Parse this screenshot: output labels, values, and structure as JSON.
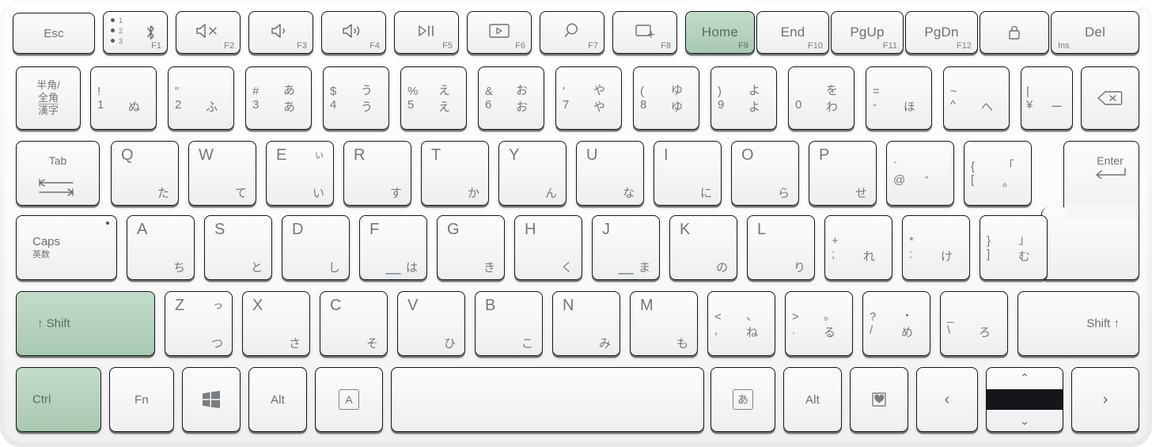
{
  "device": {
    "name": "compact-bluetooth-keyboard",
    "layout": "Japanese JIS 86-key",
    "body_color": "#f4f4f4",
    "key_color": "#f6f7f8",
    "highlight_color": "#b4d2bc",
    "legend_color": "#6d7175"
  },
  "highlighted_keys": [
    "Home",
    "Shift (left)",
    "Ctrl"
  ],
  "rows": {
    "function_row": [
      {
        "id": "esc",
        "main": "Esc"
      },
      {
        "id": "bt",
        "fn": "F1",
        "bt_items": [
          "1",
          "2",
          "3"
        ],
        "icon": "bluetooth-icon"
      },
      {
        "id": "mute",
        "fn": "F2",
        "icon": "volume-mute-icon"
      },
      {
        "id": "voldown",
        "fn": "F3",
        "icon": "volume-down-icon"
      },
      {
        "id": "volup",
        "fn": "F4",
        "icon": "volume-up-icon"
      },
      {
        "id": "playpause",
        "fn": "F5",
        "icon": "play-pause-icon"
      },
      {
        "id": "media",
        "fn": "F6",
        "icon": "media-screen-icon"
      },
      {
        "id": "search",
        "fn": "F7",
        "icon": "search-icon"
      },
      {
        "id": "newwindow",
        "fn": "F8",
        "icon": "new-window-icon"
      },
      {
        "id": "home",
        "fn": "F9",
        "main": "Home",
        "highlight": true
      },
      {
        "id": "end",
        "fn": "F10",
        "main": "End"
      },
      {
        "id": "pgup",
        "fn": "F11",
        "main": "PgUp"
      },
      {
        "id": "pgdn",
        "fn": "F12",
        "main": "PgDn"
      },
      {
        "id": "lock",
        "icon": "lock-icon"
      },
      {
        "id": "del",
        "main": "Del",
        "sub": "Ins"
      }
    ],
    "number_row": [
      {
        "id": "hankaku",
        "lines": [
          "半角/",
          "全角",
          "漢字"
        ]
      },
      {
        "id": "1",
        "tl": "!",
        "tr": "",
        "bl": "1",
        "br": "ぬ"
      },
      {
        "id": "2",
        "tl": "\"",
        "tr": "",
        "bl": "2",
        "br": "ふ"
      },
      {
        "id": "3",
        "tl": "#",
        "tr": "あ",
        "bl": "3",
        "br": "あ"
      },
      {
        "id": "4",
        "tl": "$",
        "tr": "う",
        "bl": "4",
        "br": "う"
      },
      {
        "id": "5",
        "tl": "%",
        "tr": "え",
        "bl": "5",
        "br": "え"
      },
      {
        "id": "6",
        "tl": "&",
        "tr": "お",
        "bl": "6",
        "br": "お"
      },
      {
        "id": "7",
        "tl": "'",
        "tr": "や",
        "bl": "7",
        "br": "や"
      },
      {
        "id": "8",
        "tl": "(",
        "tr": "ゆ",
        "bl": "8",
        "br": "ゆ"
      },
      {
        "id": "9",
        "tl": ")",
        "tr": "よ",
        "bl": "9",
        "br": "よ"
      },
      {
        "id": "0",
        "tl": "",
        "tr": "を",
        "bl": "0",
        "br": "わ"
      },
      {
        "id": "minus",
        "tl": "=",
        "tr": "",
        "bl": "-",
        "br": "ほ"
      },
      {
        "id": "caret",
        "tl": "~",
        "tr": "",
        "bl": "^",
        "br": "へ"
      },
      {
        "id": "yen",
        "tl": "|",
        "tr": "",
        "bl": "¥",
        "br": "ー"
      },
      {
        "id": "backspace",
        "icon": "backspace-icon"
      }
    ],
    "tab_row": [
      {
        "id": "tab",
        "main": "Tab",
        "icon": "tab-arrows-icon"
      },
      {
        "id": "q",
        "roman": "Q",
        "kana": "た"
      },
      {
        "id": "w",
        "roman": "W",
        "kana": "て"
      },
      {
        "id": "e",
        "roman": "E",
        "kana": "い",
        "kana_top": "ぃ"
      },
      {
        "id": "r",
        "roman": "R",
        "kana": "す"
      },
      {
        "id": "t",
        "roman": "T",
        "kana": "か"
      },
      {
        "id": "y",
        "roman": "Y",
        "kana": "ん"
      },
      {
        "id": "u",
        "roman": "U",
        "kana": "な"
      },
      {
        "id": "i",
        "roman": "I",
        "kana": "に"
      },
      {
        "id": "o",
        "roman": "O",
        "kana": "ら"
      },
      {
        "id": "p",
        "roman": "P",
        "kana": "せ"
      },
      {
        "id": "at",
        "tl": "`",
        "tr": "",
        "bl": "@",
        "br": "゛"
      },
      {
        "id": "bracketleft",
        "tl": "{",
        "tr": "「",
        "bl": "[",
        "br": "。"
      },
      {
        "id": "enter",
        "main": "Enter",
        "icon": "enter-arrow-icon"
      }
    ],
    "home_row": [
      {
        "id": "caps",
        "main": "Caps",
        "sub": "英数",
        "led": true
      },
      {
        "id": "a",
        "roman": "A",
        "kana": "ち"
      },
      {
        "id": "s",
        "roman": "S",
        "kana": "と"
      },
      {
        "id": "d",
        "roman": "D",
        "kana": "し"
      },
      {
        "id": "f",
        "roman": "F",
        "kana": "は",
        "homing": true
      },
      {
        "id": "g",
        "roman": "G",
        "kana": "き"
      },
      {
        "id": "h",
        "roman": "H",
        "kana": "く"
      },
      {
        "id": "j",
        "roman": "J",
        "kana": "ま",
        "homing": true
      },
      {
        "id": "k",
        "roman": "K",
        "kana": "の"
      },
      {
        "id": "l",
        "roman": "L",
        "kana": "り"
      },
      {
        "id": "semicolon",
        "tl": "+",
        "tr": "",
        "bl": ";",
        "br": "れ"
      },
      {
        "id": "colon",
        "tl": "*",
        "tr": "",
        "bl": ":",
        "br": "け"
      },
      {
        "id": "bracketright",
        "tl": "}",
        "tr": "」",
        "bl": "]",
        "br": "む"
      }
    ],
    "shift_row": [
      {
        "id": "lshift",
        "main": "↑ Shift",
        "highlight": true
      },
      {
        "id": "z",
        "roman": "Z",
        "kana": "つ",
        "kana_top": "っ"
      },
      {
        "id": "x",
        "roman": "X",
        "kana": "さ"
      },
      {
        "id": "c",
        "roman": "C",
        "kana": "そ"
      },
      {
        "id": "v",
        "roman": "V",
        "kana": "ひ"
      },
      {
        "id": "b",
        "roman": "B",
        "kana": "こ"
      },
      {
        "id": "n",
        "roman": "N",
        "kana": "み"
      },
      {
        "id": "m",
        "roman": "M",
        "kana": "も"
      },
      {
        "id": "comma",
        "tl": "<",
        "tr": "、",
        "bl": ",",
        "br": "ね"
      },
      {
        "id": "period",
        "tl": ">",
        "tr": "。",
        "bl": ".",
        "br": "る"
      },
      {
        "id": "slash",
        "tl": "?",
        "tr": "・",
        "bl": "/",
        "br": "め"
      },
      {
        "id": "backslash",
        "tl": "_",
        "tr": "",
        "bl": "\\",
        "br": "ろ"
      },
      {
        "id": "rshift",
        "main": "Shift ↑"
      }
    ],
    "bottom_row": [
      {
        "id": "ctrl",
        "main": "Ctrl",
        "highlight": true
      },
      {
        "id": "fn",
        "main": "Fn"
      },
      {
        "id": "win",
        "icon": "windows-icon"
      },
      {
        "id": "lalt",
        "main": "Alt"
      },
      {
        "id": "eisu",
        "boxed": "A",
        "icon": "boxed-a-icon"
      },
      {
        "id": "space",
        "main": ""
      },
      {
        "id": "kana",
        "boxed": "あ",
        "icon": "boxed-a-kana-icon"
      },
      {
        "id": "ralt",
        "main": "Alt"
      },
      {
        "id": "favorite",
        "icon": "heart-note-icon"
      },
      {
        "id": "left",
        "main": "‹",
        "icon": "arrow-left-icon"
      },
      {
        "id": "updown",
        "up": "⌃",
        "down": "⌄",
        "icon": "arrow-up-down-icon"
      },
      {
        "id": "right",
        "main": "›",
        "icon": "arrow-right-icon"
      }
    ]
  }
}
